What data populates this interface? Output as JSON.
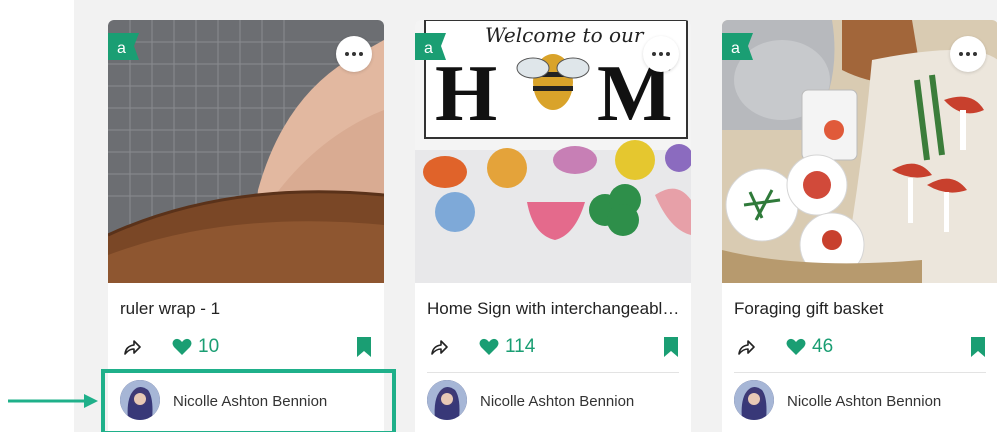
{
  "colors": {
    "accent": "#1a9e73",
    "highlight": "#1fb08a",
    "badge": "#1a9e73"
  },
  "icons": {
    "badge": "a-badge-icon",
    "more": "more-horizontal-icon",
    "share": "share-icon",
    "like": "heart-icon",
    "save": "bookmark-icon"
  },
  "cards": [
    {
      "badge": "a",
      "title": "ruler wrap - 1",
      "likes": "10",
      "author": "Nicolle Ashton Bennion"
    },
    {
      "badge": "a",
      "title": "Home Sign with interchangeable tiles",
      "likes": "114",
      "author": "Nicolle Ashton Bennion",
      "image_text": {
        "script": "Welcome to our",
        "word_left": "H",
        "word_right": "M"
      }
    },
    {
      "badge": "a",
      "title": "Foraging gift basket",
      "likes": "46",
      "author": "Nicolle Ashton Bennion"
    }
  ]
}
